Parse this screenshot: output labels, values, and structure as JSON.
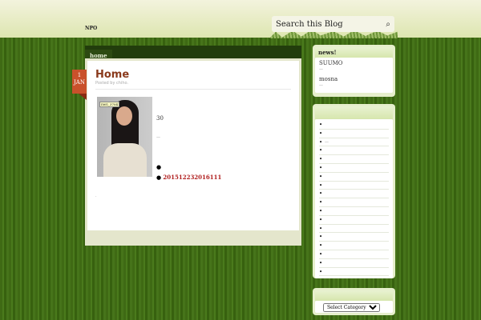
{
  "header": {
    "logo": "NPO",
    "search_placeholder": "Search this Blog"
  },
  "nav": {
    "items": [
      "home"
    ]
  },
  "post": {
    "day": "1",
    "month": "JAN",
    "title": "Home",
    "meta": "Posted by chiho.",
    "image_tag": "IMG_3704",
    "text1": "30",
    "dash": "—",
    "bullet1": "",
    "link": "201512232016111",
    "trailing": "."
  },
  "sidebar": {
    "news": {
      "title": "news!",
      "items": [
        {
          "label": "SUUMO",
          "sub": "—"
        },
        {
          "label": "mosna",
          "sub": "—"
        }
      ]
    },
    "list": {
      "title": "",
      "items": [
        "",
        "",
        "—",
        "",
        "",
        "",
        "",
        "",
        "",
        "",
        "",
        "",
        "",
        "",
        "",
        "",
        "",
        ""
      ]
    },
    "category": {
      "title": "",
      "select": "Select Category"
    }
  }
}
